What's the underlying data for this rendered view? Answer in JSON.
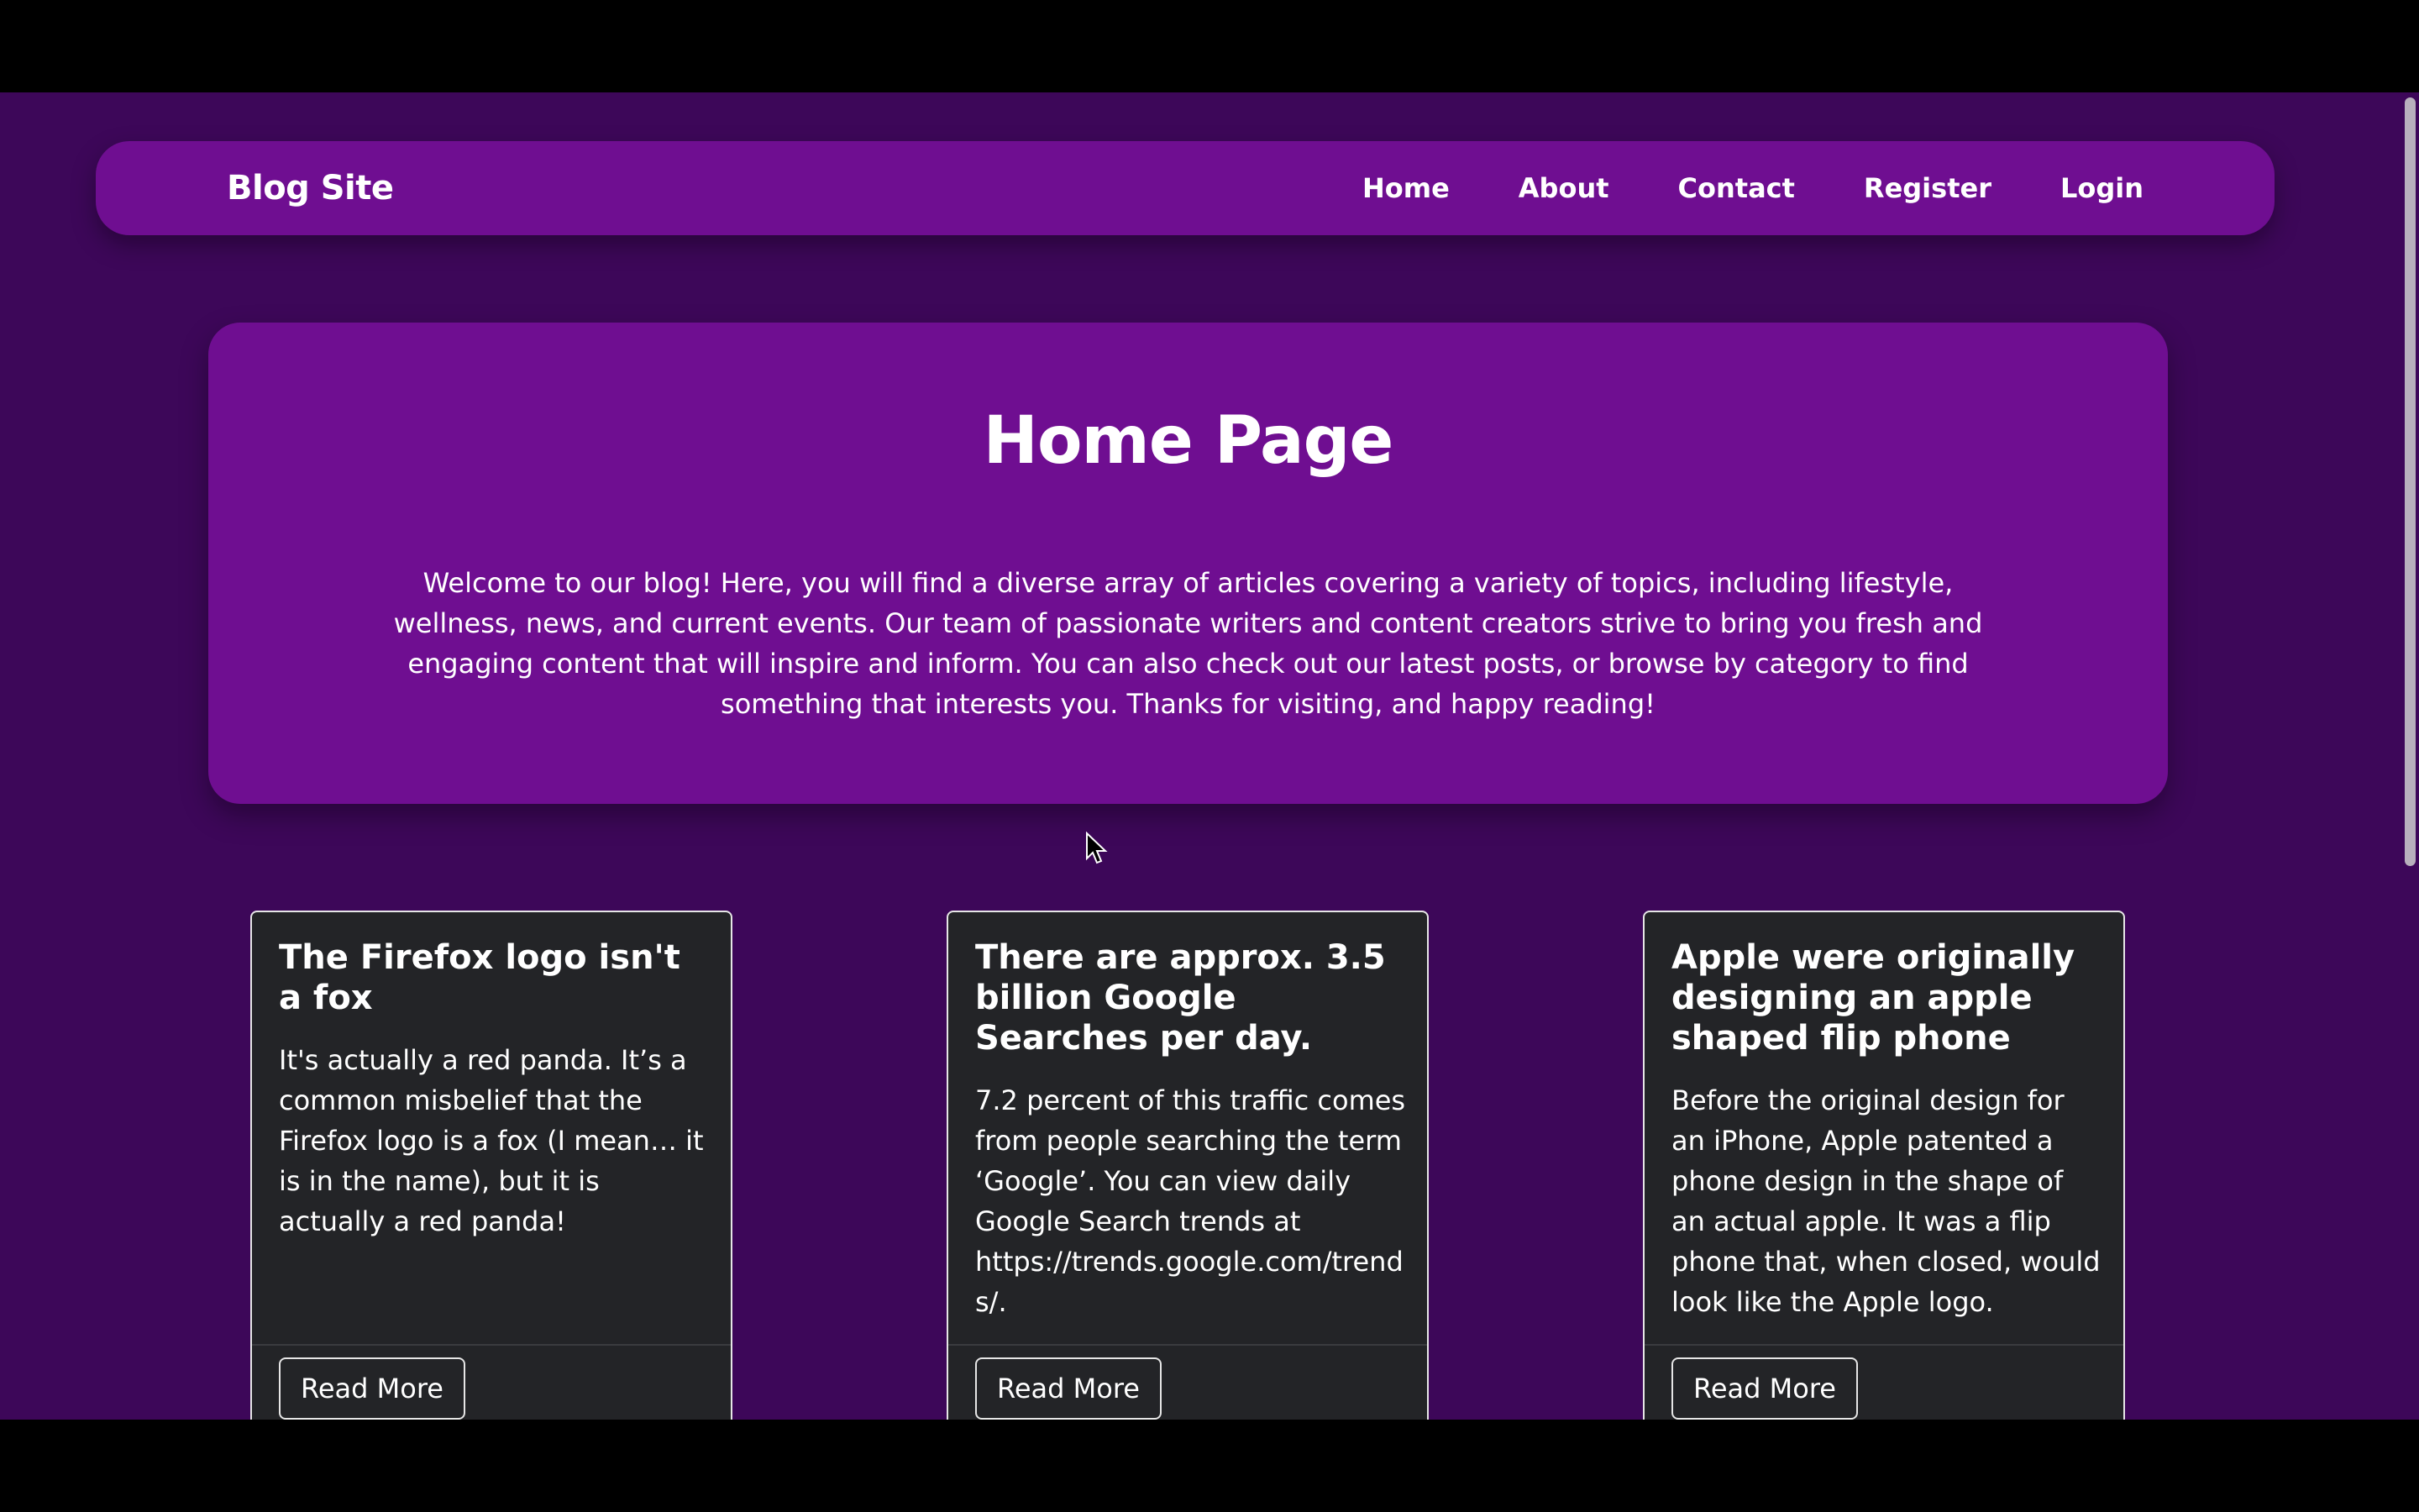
{
  "navbar": {
    "brand": "Blog Site",
    "links": [
      "Home",
      "About",
      "Contact",
      "Register",
      "Login"
    ]
  },
  "hero": {
    "title": "Home Page",
    "text": "Welcome to our blog! Here, you will find a diverse array of articles covering a variety of topics, including lifestyle, wellness, news, and current events. Our team of passionate writers and content creators strive to bring you fresh and engaging content that will inspire and inform. You can also check out our latest posts, or browse by category to find something that interests you. Thanks for visiting, and happy reading!"
  },
  "cards": [
    {
      "title": "The Firefox logo isn't a fox",
      "body": "It's actually a red panda. It’s a common misbelief that the Firefox logo is a fox (I mean… it is in the name), but it is actually a red panda!",
      "button": "Read More"
    },
    {
      "title": "There are approx. 3.5 billion Google Searches per day.",
      "body": "7.2 percent of this traffic comes from people searching the term ‘Google’. You can view daily Google Search trends at https://trends.google.com/trends/.",
      "button": "Read More"
    },
    {
      "title": "Apple were originally designing an apple shaped flip phone",
      "body": "Before the original design for an iPhone, Apple patented a phone design in the shape of an actual apple. It was a flip phone that, when closed, would look like the Apple logo.",
      "button": "Read More"
    }
  ],
  "colors": {
    "page_background": "#3d0759",
    "panel_purple": "#6f0e91",
    "card_background": "#232427",
    "text": "#ffffff"
  }
}
